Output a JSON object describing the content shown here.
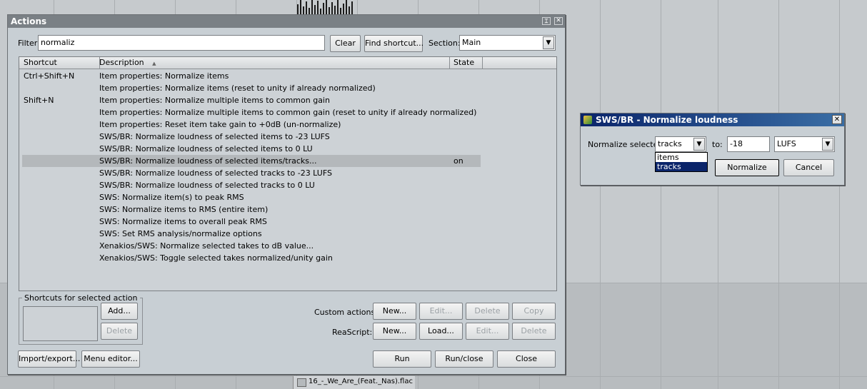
{
  "media_item": {
    "name": "16_-_We_Are_(Feat._Nas).flac"
  },
  "actions": {
    "title": "Actions",
    "filter_label": "Filter:",
    "filter_value": "normaliz",
    "clear_label": "Clear",
    "find_shortcut_label": "Find shortcut...",
    "section_label": "Section:",
    "section_value": "Main",
    "columns": [
      "Shortcut",
      "Description",
      "State"
    ],
    "sort_indicator": "▲",
    "rows": [
      {
        "shortcut": "Ctrl+Shift+N",
        "description": "Item properties: Normalize items",
        "state": ""
      },
      {
        "shortcut": "",
        "description": "Item properties: Normalize items (reset to unity if already normalized)",
        "state": ""
      },
      {
        "shortcut": "Shift+N",
        "description": "Item properties: Normalize multiple items to common gain",
        "state": ""
      },
      {
        "shortcut": "",
        "description": "Item properties: Normalize multiple items to common gain (reset to unity if already normalized)",
        "state": ""
      },
      {
        "shortcut": "",
        "description": "Item properties: Reset item take gain to +0dB (un-normalize)",
        "state": ""
      },
      {
        "shortcut": "",
        "description": "SWS/BR: Normalize loudness of selected items to -23 LUFS",
        "state": ""
      },
      {
        "shortcut": "",
        "description": "SWS/BR: Normalize loudness of selected items to 0 LU",
        "state": ""
      },
      {
        "shortcut": "",
        "description": "SWS/BR: Normalize loudness of selected items/tracks...",
        "state": "on",
        "selected": true
      },
      {
        "shortcut": "",
        "description": "SWS/BR: Normalize loudness of selected tracks to -23 LUFS",
        "state": ""
      },
      {
        "shortcut": "",
        "description": "SWS/BR: Normalize loudness of selected tracks to 0 LU",
        "state": ""
      },
      {
        "shortcut": "",
        "description": "SWS: Normalize item(s) to peak RMS",
        "state": ""
      },
      {
        "shortcut": "",
        "description": "SWS: Normalize items to RMS (entire item)",
        "state": ""
      },
      {
        "shortcut": "",
        "description": "SWS: Normalize items to overall peak RMS",
        "state": ""
      },
      {
        "shortcut": "",
        "description": "SWS: Set RMS analysis/normalize options",
        "state": ""
      },
      {
        "shortcut": "",
        "description": "Xenakios/SWS: Normalize selected takes to dB value...",
        "state": ""
      },
      {
        "shortcut": "",
        "description": "Xenakios/SWS: Toggle selected takes normalized/unity gain",
        "state": ""
      }
    ],
    "shortcuts_group_label": "Shortcuts for selected action",
    "add_label": "Add...",
    "delete_label": "Delete",
    "custom_actions_label": "Custom actions:",
    "reascript_label": "ReaScript:",
    "new_label": "New...",
    "edit_label": "Edit...",
    "copy_label": "Copy",
    "load_label": "Load...",
    "import_export_label": "Import/export...",
    "menu_editor_label": "Menu editor...",
    "run_label": "Run",
    "run_close_label": "Run/close",
    "close_label": "Close"
  },
  "normalize": {
    "title": "SWS/BR - Normalize loudness",
    "normalize_selected_label": "Normalize selected",
    "target_value": "tracks",
    "target_options": [
      "items",
      "tracks"
    ],
    "to_label": "to:",
    "level_value": "-18",
    "unit_value": "LUFS",
    "normalize_button": "Normalize",
    "cancel_button": "Cancel"
  },
  "colors": {
    "title_active": "#0a246a",
    "title_inactive": "#7a8085",
    "selected_row": "#b4b8bb",
    "dropdown_highlight": "#0a246a"
  }
}
